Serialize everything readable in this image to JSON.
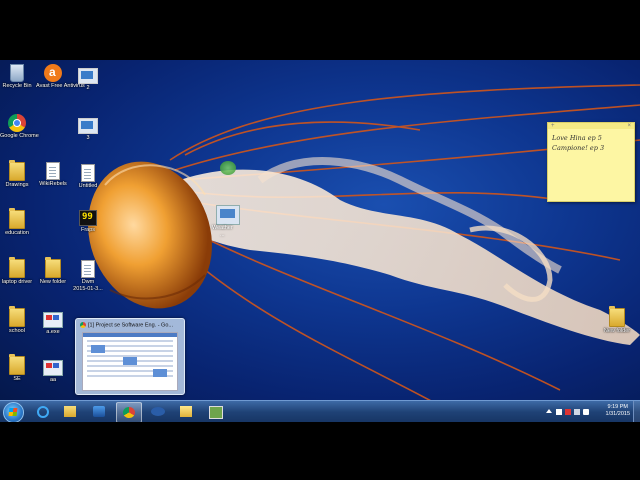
{
  "desktop": {
    "icons": {
      "recycle_bin": "Recycle Bin",
      "avast": "Avast Free Antivirus",
      "shot_2": "2",
      "chrome": "Google Chrome",
      "shot_3": "3",
      "drawings": "Drawings",
      "wikirebels": "WikiRebels",
      "untitled": "Untitled",
      "education": "education",
      "fraps": "Fraps",
      "laptop_driver": "laptop driver",
      "new_folder": "New folder",
      "dwm": "Dwm",
      "dwm_date": "2015-01-3...",
      "school": "school",
      "exe1": "a.exe",
      "se": "SE",
      "exe2": "aa",
      "new_folder_right": "New folder"
    },
    "dragging": {
      "label1": "Weather",
      "label2": "..."
    }
  },
  "sticky_note": {
    "line1": "Love Hina ep 5",
    "line2": "Campione! ep 3",
    "add": "+",
    "close": "×"
  },
  "thumbnail": {
    "title": "[1] Project se Software Eng. - Go..."
  },
  "taskbar": {
    "clock_time": "9:19 PM",
    "clock_date": "1/31/2015",
    "colors": {
      "bar": "#1f4276",
      "accent": "#3d6aa6"
    },
    "pinned": [
      "start-orb",
      "ie-icon",
      "explorer-icon",
      "media-player-icon",
      "chrome-icon",
      "network-icon",
      "folder-icon",
      "screen-icon"
    ]
  }
}
